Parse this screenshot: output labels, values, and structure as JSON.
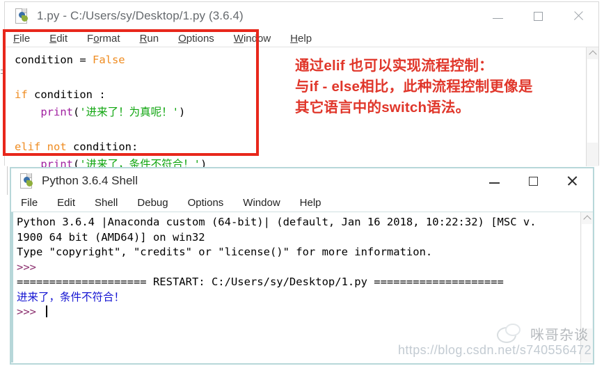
{
  "editor_window": {
    "title": "1.py - C:/Users/sy/Desktop/1.py (3.6.4)",
    "icon": "python-file-icon",
    "menus": [
      {
        "pre": "",
        "accel": "F",
        "post": "ile"
      },
      {
        "pre": "",
        "accel": "E",
        "post": "dit"
      },
      {
        "pre": "F",
        "accel": "o",
        "post": "rmat"
      },
      {
        "pre": "",
        "accel": "R",
        "post": "un"
      },
      {
        "pre": "",
        "accel": "O",
        "post": "ptions"
      },
      {
        "pre": "",
        "accel": "W",
        "post": "indow"
      },
      {
        "pre": "",
        "accel": "H",
        "post": "elp"
      }
    ],
    "window_buttons": {
      "minimize": "minimize-icon",
      "maximize": "maximize-icon",
      "close": "close-icon"
    },
    "code_lines": [
      "condition = False",
      "",
      "if condition :",
      "    print('进来了！为真呢！')",
      "",
      "elif not condition:",
      "    print('进来了，条件不符合！')"
    ],
    "code_tokens": {
      "l1_name": "condition = ",
      "l1_kw": "False",
      "l3_kw": "if",
      "l3_rest": " condition :",
      "l4_indent": "    ",
      "l4_fn": "print",
      "l4_open": "(",
      "l4_str": "'进来了！为真呢！'",
      "l4_close": ")",
      "l6_kw1": "elif",
      "l6_kw2": "not",
      "l6_rest": " condition:",
      "l7_indent": "    ",
      "l7_fn": "print",
      "l7_open": "(",
      "l7_str": "'进来了，条件不符合！'",
      "l7_close": ")"
    },
    "scrollbar": {
      "up_arrow": "scroll-up-arrow-icon"
    }
  },
  "annotation": {
    "color": "#e0362a",
    "box_color": "#e8271b",
    "lines": [
      "通过elif 也可以实现流程控制：",
      "与if - else相比，此种流程控制更像是",
      "其它语言中的switch语法。"
    ]
  },
  "shell_window": {
    "title": "Python 3.6.4 Shell",
    "icon": "python-file-icon",
    "menus": [
      "File",
      "Edit",
      "Shell",
      "Debug",
      "Options",
      "Window",
      "Help"
    ],
    "window_buttons": {
      "minimize": "minimize-icon",
      "maximize": "maximize-icon",
      "close": "close-icon"
    },
    "output": {
      "banner_line1": "Python 3.6.4 |Anaconda custom (64-bit)| (default, Jan 16 2018, 10:22:32) [MSC v.",
      "banner_line2": "1900 64 bit (AMD64)] on win32",
      "banner_line3": "Type \"copyright\", \"credits\" or \"license()\" for more information.",
      "prompt1": ">>> ",
      "restart_line": "==================== RESTART: C:/Users/sy/Desktop/1.py ====================",
      "program_output": "进来了，条件不符合！",
      "prompt2": ">>> "
    },
    "scrollbar": {
      "up_arrow": "scroll-up-arrow-icon"
    }
  },
  "watermark": {
    "brand": "咪哥杂谈",
    "logo": "wechat-logo",
    "url": "https://blog.csdn.net/s740556472"
  }
}
